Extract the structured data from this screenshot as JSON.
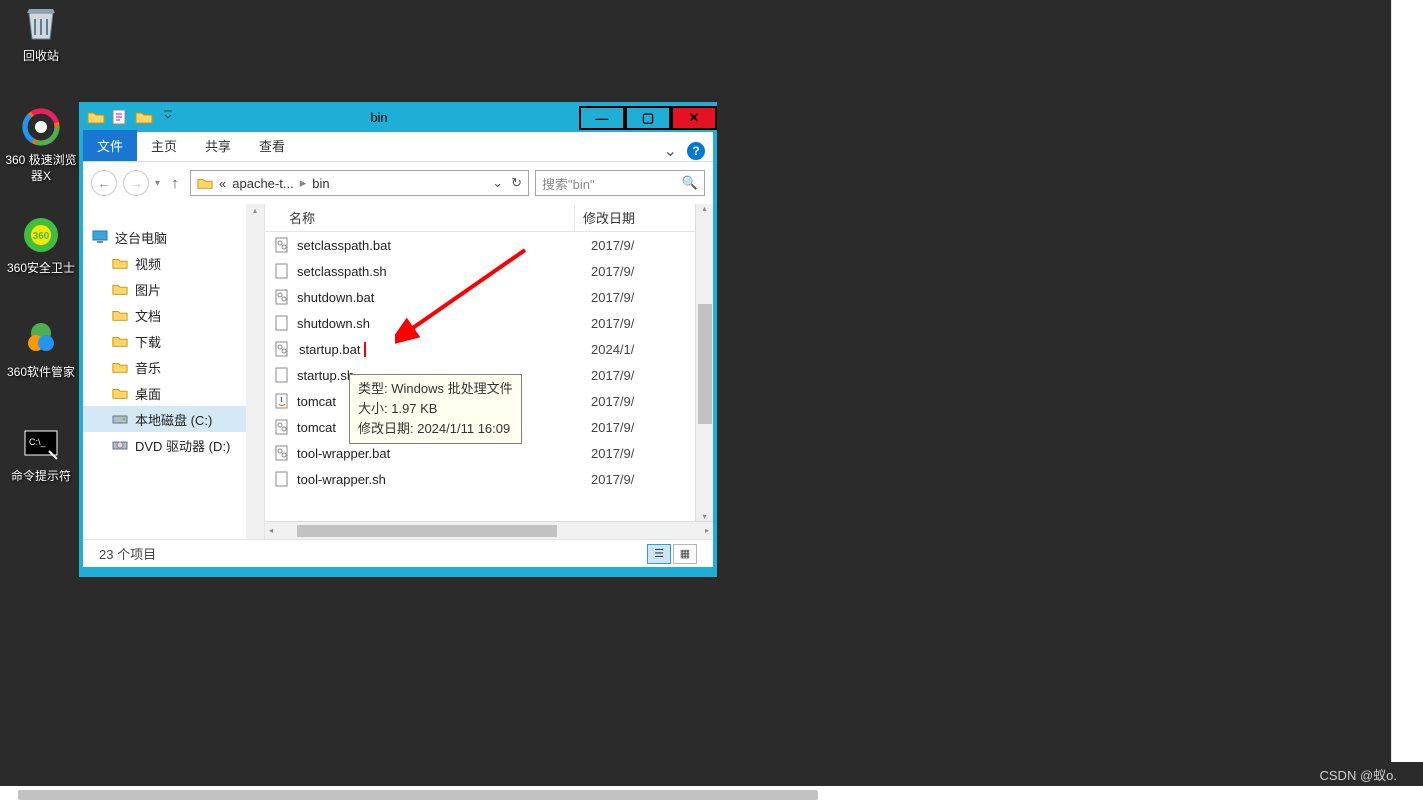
{
  "desktop": {
    "icons": [
      {
        "label": "回收站",
        "icon": "recycle-bin"
      },
      {
        "label": "360 极速浏览器X",
        "icon": "360-browser"
      },
      {
        "label": "360安全卫士",
        "icon": "360-safe"
      },
      {
        "label": "360软件管家",
        "icon": "360-software"
      },
      {
        "label": "命令提示符",
        "icon": "cmd"
      }
    ]
  },
  "explorer": {
    "title": "bin",
    "ribbon": {
      "tabs": [
        "文件",
        "主页",
        "共享",
        "查看"
      ],
      "active_index": 0,
      "chevron": "⌄"
    },
    "address": {
      "crumb1": "apache-t...",
      "crumb2": "bin",
      "prefix": "«"
    },
    "search": {
      "placeholder": "搜索\"bin\""
    },
    "tree": {
      "this_pc": "这台电脑",
      "items": [
        {
          "label": "视频",
          "icon": "folder"
        },
        {
          "label": "图片",
          "icon": "folder"
        },
        {
          "label": "文档",
          "icon": "folder"
        },
        {
          "label": "下载",
          "icon": "folder"
        },
        {
          "label": "音乐",
          "icon": "folder"
        },
        {
          "label": "桌面",
          "icon": "folder"
        },
        {
          "label": "本地磁盘 (C:)",
          "icon": "drive",
          "selected": true
        },
        {
          "label": "DVD 驱动器 (D:)",
          "icon": "dvd"
        }
      ]
    },
    "columns": {
      "name": "名称",
      "date": "修改日期"
    },
    "files": [
      {
        "name": "setclasspath.bat",
        "date": "2017/9/",
        "icon": "bat"
      },
      {
        "name": "setclasspath.sh",
        "date": "2017/9/",
        "icon": "file"
      },
      {
        "name": "shutdown.bat",
        "date": "2017/9/",
        "icon": "bat"
      },
      {
        "name": "shutdown.sh",
        "date": "2017/9/",
        "icon": "file"
      },
      {
        "name": "startup.bat",
        "date": "2024/1/",
        "icon": "bat",
        "highlight": true
      },
      {
        "name": "startup.sh",
        "date": "2017/9/",
        "icon": "file"
      },
      {
        "name": "tomcat",
        "date": "2017/9/",
        "icon": "java"
      },
      {
        "name": "tomcat",
        "date": "2017/9/",
        "icon": "bat"
      },
      {
        "name": "tool-wrapper.bat",
        "date": "2017/9/",
        "icon": "bat"
      },
      {
        "name": "tool-wrapper.sh",
        "date": "2017/9/",
        "icon": "file"
      }
    ],
    "tooltip": {
      "line1": "类型: Windows 批处理文件",
      "line2": "大小: 1.97 KB",
      "line3": "修改日期: 2024/1/11 16:09"
    },
    "status": {
      "count": "23 个项目"
    }
  },
  "watermark": "CSDN @蚁o."
}
